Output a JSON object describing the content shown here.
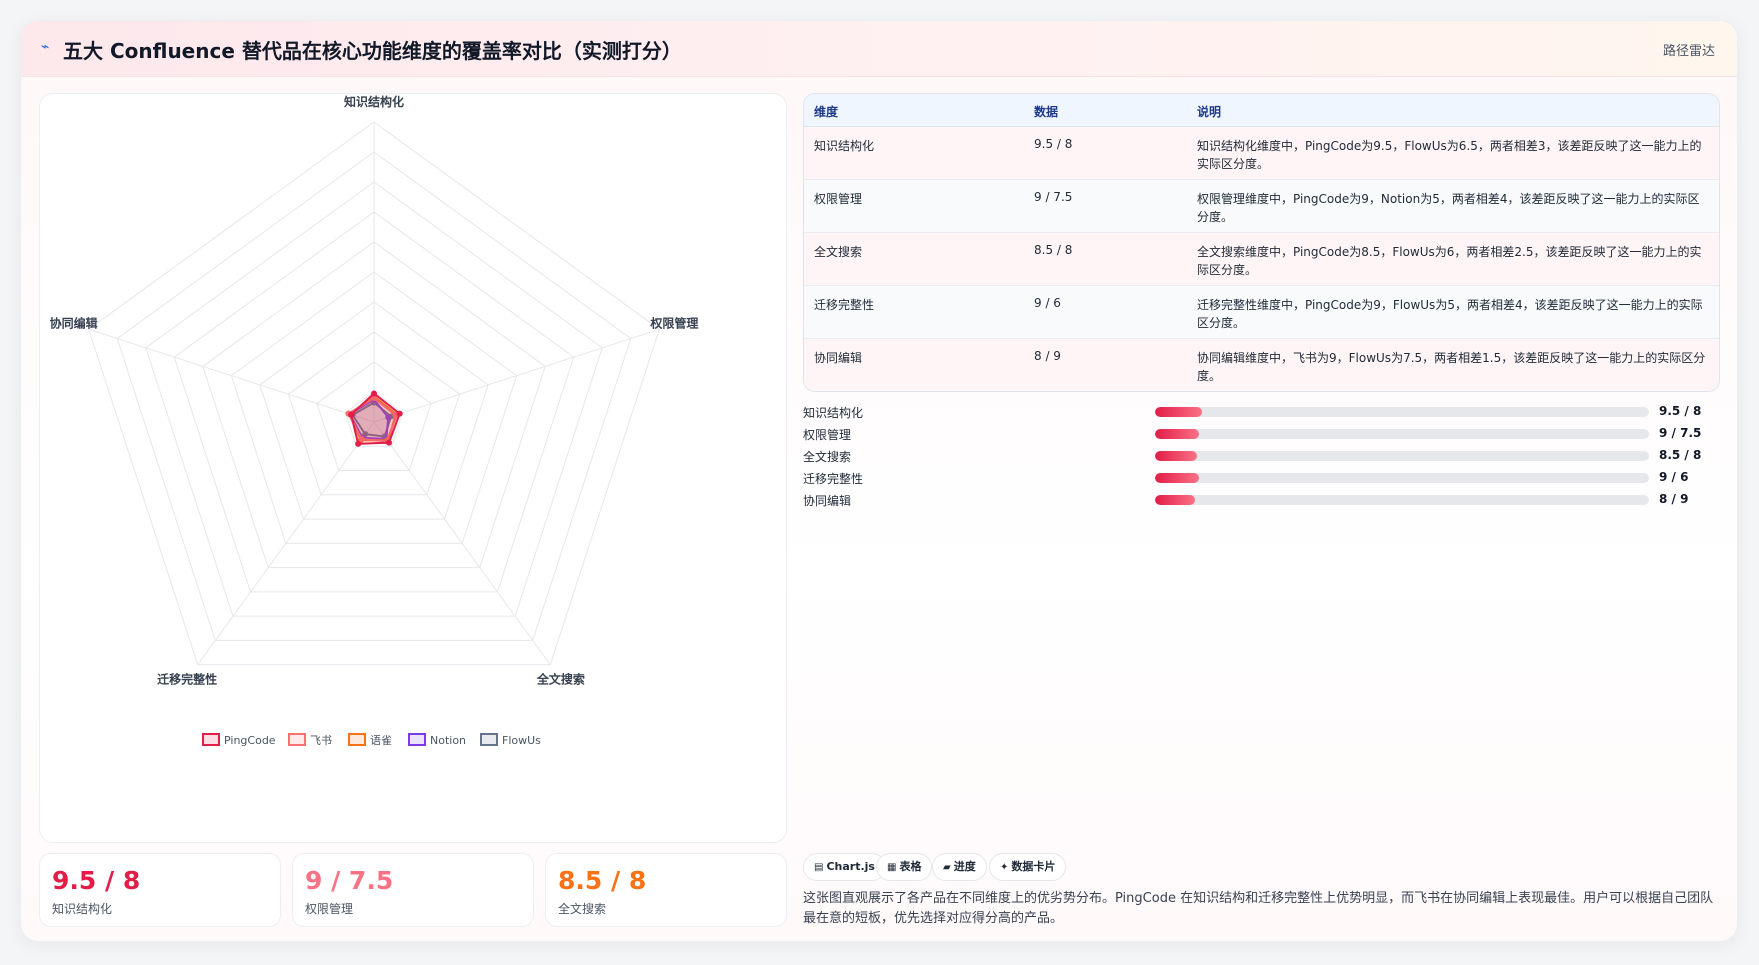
{
  "header": {
    "icon": "bolt-icon",
    "title": "五大 Confluence 替代品在核心功能维度的覆盖率对比（实测打分）",
    "tag": "路径雷达"
  },
  "chart_data": {
    "type": "radar",
    "categories": [
      "知识结构化",
      "权限管理",
      "全文搜索",
      "迁移完整性",
      "协同编辑"
    ],
    "rmax": 100,
    "rings": 10,
    "series": [
      {
        "name": "PingCode",
        "color": "#e11d48",
        "values": [
          9.5,
          9,
          8.5,
          9,
          8
        ]
      },
      {
        "name": "飞书",
        "color": "#f87171",
        "values": [
          8,
          7.5,
          8,
          7,
          9
        ]
      },
      {
        "name": "语雀",
        "color": "#f97316",
        "values": [
          8.5,
          8,
          7.5,
          7.5,
          8.5
        ]
      },
      {
        "name": "Notion",
        "color": "#7c3aed",
        "values": [
          7.5,
          5,
          7,
          6.5,
          8.5
        ]
      },
      {
        "name": "FlowUs",
        "color": "#64748b",
        "values": [
          6.5,
          6,
          6,
          5,
          7.5
        ]
      }
    ],
    "legend_position": "bottom-center"
  },
  "stats": [
    {
      "value": "9.5 / 8",
      "label": "知识结构化",
      "color": "#e11d48"
    },
    {
      "value": "9 / 7.5",
      "label": "权限管理",
      "color": "#f87185"
    },
    {
      "value": "8.5 / 8",
      "label": "全文搜索",
      "color": "#f97316"
    }
  ],
  "table": {
    "headers": [
      "维度",
      "数据",
      "说明"
    ],
    "rows": [
      [
        "知识结构化",
        "9.5 / 8",
        "知识结构化维度中，PingCode为9.5，FlowUs为6.5，两者相差3，该差距反映了这一能力上的实际区分度。"
      ],
      [
        "权限管理",
        "9 / 7.5",
        "权限管理维度中，PingCode为9，Notion为5，两者相差4，该差距反映了这一能力上的实际区分度。"
      ],
      [
        "全文搜索",
        "8.5 / 8",
        "全文搜索维度中，PingCode为8.5，FlowUs为6，两者相差2.5，该差距反映了这一能力上的实际区分度。"
      ],
      [
        "迁移完整性",
        "9 / 6",
        "迁移完整性维度中，PingCode为9，FlowUs为5，两者相差4，该差距反映了这一能力上的实际区分度。"
      ],
      [
        "协同编辑",
        "8 / 9",
        "协同编辑维度中，飞书为9，FlowUs为7.5，两者相差1.5，该差距反映了这一能力上的实际区分度。"
      ]
    ]
  },
  "bars": [
    {
      "label": "知识结构化",
      "value": "9.5 / 8",
      "fraction": 0.095
    },
    {
      "label": "权限管理",
      "value": "9 / 7.5",
      "fraction": 0.09
    },
    {
      "label": "全文搜索",
      "value": "8.5 / 8",
      "fraction": 0.085
    },
    {
      "label": "迁移完整性",
      "value": "9 / 6",
      "fraction": 0.09
    },
    {
      "label": "协同编辑",
      "value": "8 / 9",
      "fraction": 0.08
    }
  ],
  "chips": [
    {
      "icon": "chart-icon",
      "glyph": "▤",
      "label": "Chart.js"
    },
    {
      "icon": "table-icon",
      "glyph": "▦",
      "label": "表格"
    },
    {
      "icon": "progress-icon",
      "glyph": "▰",
      "label": "进度"
    },
    {
      "icon": "sparkle-icon",
      "glyph": "✦",
      "label": "数据卡片"
    }
  ],
  "footer": "这张图直观展示了各产品在不同维度上的优劣势分布。PingCode 在知识结构和迁移完整性上优势明显，而飞书在协同编辑上表现最佳。用户可以根据自己团队最在意的短板，优先选择对应得分高的产品。"
}
